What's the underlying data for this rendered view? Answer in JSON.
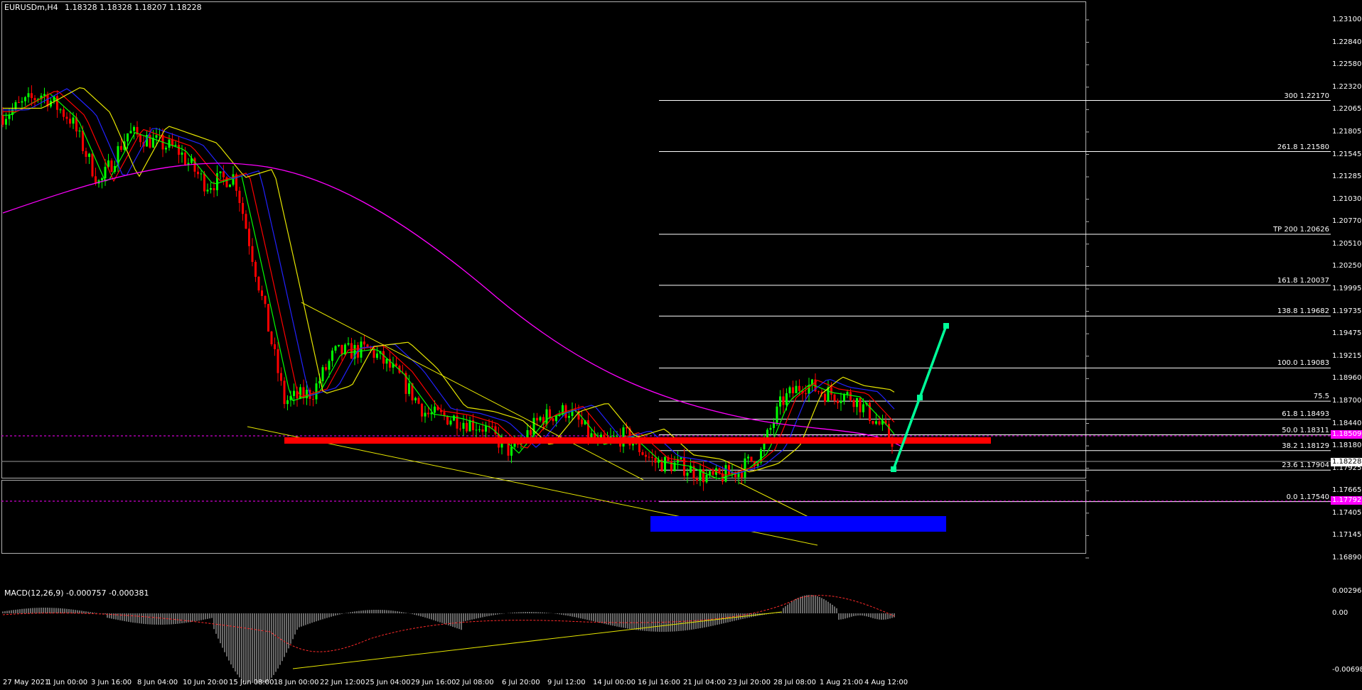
{
  "header": {
    "symbol": "EURUSDm,H4",
    "ohlc": "1.18328 1.18328 1.18207 1.18228"
  },
  "price_axis": [
    "1.23100",
    "1.22840",
    "1.22580",
    "1.22320",
    "1.22065",
    "1.21805",
    "1.21545",
    "1.21285",
    "1.21030",
    "1.20770",
    "1.20510",
    "1.20250",
    "1.19995",
    "1.19735",
    "1.19475",
    "1.19215",
    "1.18960",
    "1.18700",
    "1.18440",
    "1.18180",
    "1.17925",
    "1.17665",
    "1.17405",
    "1.17145",
    "1.16890"
  ],
  "price_tags": {
    "current": "1.18228",
    "upper_pink": "1.18509",
    "lower_pink": "1.17792"
  },
  "fib_levels": [
    {
      "label": "300 1.22170",
      "price": 1.2217
    },
    {
      "label": "261.8 1.21580",
      "price": 1.2158
    },
    {
      "label": "TP 200 1.20626",
      "price": 1.20626
    },
    {
      "label": "161.8 1.20037",
      "price": 1.20037
    },
    {
      "label": "138.8 1.19682",
      "price": 1.19682
    },
    {
      "label": "100.0 1.19083",
      "price": 1.19083
    },
    {
      "label": "75.5",
      "price": 1.187
    },
    {
      "label": "61.8 1.18493",
      "price": 1.18493
    },
    {
      "label": "50.0 1.18311",
      "price": 1.18311
    },
    {
      "label": "38.2 1.18129",
      "price": 1.18129
    },
    {
      "label": "23.6 1.17904",
      "price": 1.17904
    },
    {
      "label": "0.0 1.17540",
      "price": 1.1754
    }
  ],
  "time_axis": [
    "27 May 2021",
    "1 Jun 00:00",
    "3 Jun 16:00",
    "8 Jun 04:00",
    "10 Jun 20:00",
    "15 Jun 08:00",
    "18 Jun 00:00",
    "22 Jun 12:00",
    "25 Jun 04:00",
    "29 Jun 16:00",
    "2 Jul 08:00",
    "6 Jul 20:00",
    "9 Jul 12:00",
    "14 Jul 00:00",
    "16 Jul 16:00",
    "21 Jul 04:00",
    "23 Jul 20:00",
    "28 Jul 08:00",
    "1 Aug 21:00",
    "4 Aug 12:00"
  ],
  "macd": {
    "title": "MACD(12,26,9) -0.000757 -0.000381",
    "axis": [
      "0.002967",
      "0.00",
      "-0.006988"
    ]
  },
  "colors": {
    "bull": "#00ff00",
    "bear": "#ff0000",
    "ma_magenta": "#ff00ff",
    "ma_blue": "#2222ff",
    "trend": "#e6e600",
    "support": "#ff0000",
    "demand": "#0000ff",
    "projection": "#00ff99",
    "pink_tag": "#ff00ff"
  }
}
